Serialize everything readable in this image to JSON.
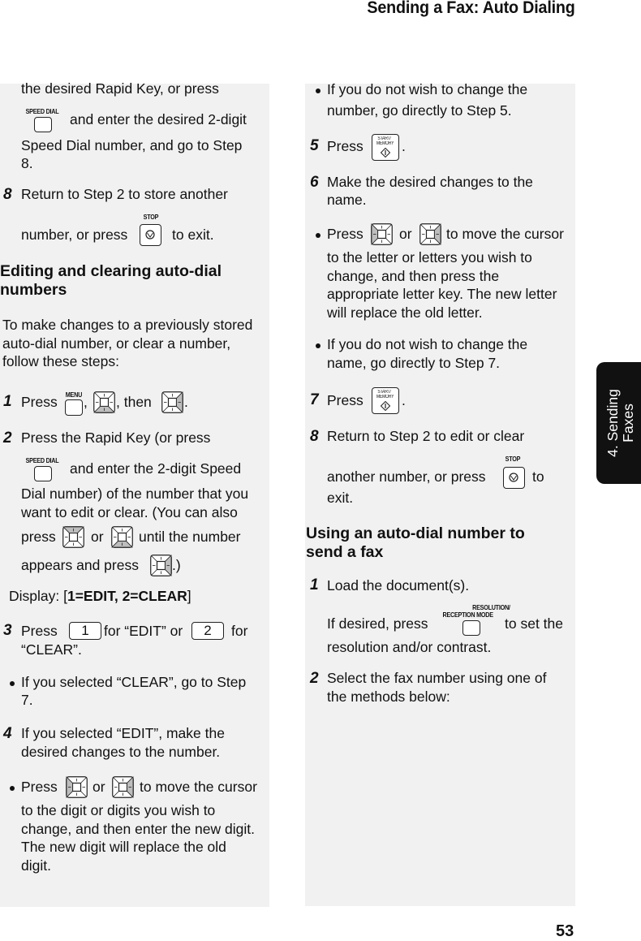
{
  "header": {
    "title": "Sending a Fax: Auto Dialing"
  },
  "side_tab": {
    "line1": "4. Sending",
    "line2": "Faxes"
  },
  "page_number": "53",
  "keys": {
    "speed_dial": "SPEED DIAL",
    "stop": "STOP",
    "menu": "MENU",
    "start_memory_line1": "START/",
    "start_memory_line2": "MEMORY",
    "resolution_line1": "RESOLUTION/",
    "resolution_line2": "RECEPTION MODE",
    "num1": "1",
    "num2": "2"
  },
  "left": {
    "cont_line1": "the desired Rapid Key, or press",
    "cont_line2": "and enter the desired 2-digit",
    "cont_line3": "Speed Dial number, and go to Step",
    "cont_line4": "8.",
    "step8": {
      "num": "8",
      "line1": "Return to Step 2 to store another",
      "line2a": "number, or press",
      "line2b": "to exit."
    },
    "section_heading_line1": "Editing and clearing auto-dial",
    "section_heading_line2": "numbers",
    "intro_line1": "To make changes to a previously stored",
    "intro_line2": "auto-dial number, or clear a number,",
    "intro_line3": "follow these steps:",
    "step1": {
      "num": "1",
      "press": "Press",
      "comma": ",",
      "then": ", then",
      "end": "."
    },
    "step2": {
      "num": "2",
      "line1": "Press the Rapid Key (or press",
      "line2": "and enter the 2-digit Speed",
      "line3": "Dial number) of the number that you",
      "line4": "want to edit or clear. (You can also",
      "line5a": "press",
      "line5b": "or",
      "line5c": "until the number",
      "line6a": "appears and press",
      "line6b": ".)"
    },
    "display": {
      "prefix": "Display: [",
      "value": "1=EDIT, 2=CLEAR",
      "suffix": "]"
    },
    "step3": {
      "num": "3",
      "press": "Press",
      "mid": "for “EDIT” or",
      "end": "for",
      "line2": "“CLEAR”."
    },
    "bullet_clear": {
      "line1": "If you selected “CLEAR”, go to Step",
      "line2": "7."
    },
    "step4": {
      "num": "4",
      "line1": "If you selected “EDIT”, make the",
      "line2": "desired changes to the number."
    },
    "bullet_press": {
      "press": "Press",
      "or": "or",
      "end": "to move the cursor",
      "line2": "to the digit or digits you wish to",
      "line3": "change, and then enter the new digit.",
      "line4": "The new digit will replace the old",
      "line5": "digit."
    }
  },
  "right": {
    "bullet_number": {
      "line1": "If you do not wish to change the",
      "line2": "number, go directly to Step 5."
    },
    "step5": {
      "num": "5",
      "press": "Press",
      "end": "."
    },
    "step6": {
      "num": "6",
      "line1": "Make the desired changes to the",
      "line2": "name."
    },
    "bullet_press": {
      "press": "Press",
      "or": "or",
      "end": "to move the cursor",
      "line2": "to the letter or letters you wish to",
      "line3": "change, and then press the",
      "line4": "appropriate letter key. The new letter",
      "line5": "will replace the old letter."
    },
    "bullet_name": {
      "line1": "If you do not wish to change the",
      "line2": "name, go directly to Step 7."
    },
    "step7": {
      "num": "7",
      "press": "Press",
      "end": "."
    },
    "step8": {
      "num": "8",
      "line1": "Return to Step 2 to edit or clear",
      "line2a": "another number, or press",
      "line2b": "to",
      "line3": "exit."
    },
    "section_heading_line1": "Using an auto-dial number to",
    "section_heading_line2": "send a fax",
    "step1": {
      "num": "1",
      "line1": "Load the document(s).",
      "line2a": "If desired, press",
      "line2b": "to set the",
      "line3": "resolution and/or contrast."
    },
    "step2": {
      "num": "2",
      "line1": "Select the fax number using one of",
      "line2": "the methods below:"
    }
  }
}
